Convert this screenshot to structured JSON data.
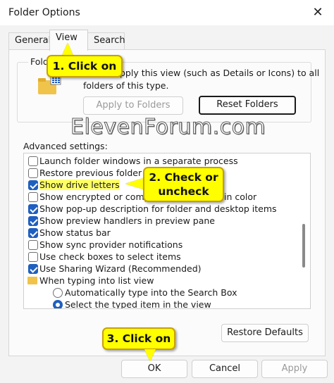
{
  "window": {
    "title": "Folder Options",
    "close_glyph": "✕"
  },
  "tabs": [
    {
      "label": "General"
    },
    {
      "label": "View"
    },
    {
      "label": "Search"
    }
  ],
  "folder_views": {
    "group_label": "Fold",
    "desc_line1": "pply this view (such as Details or Icons) to all",
    "desc_line2": "folders of this type.",
    "apply_button": "Apply to Folders",
    "reset_button": "Reset Folders"
  },
  "watermark": "ElevenForum.com",
  "advanced": {
    "label": "Advanced settings:",
    "items": [
      {
        "type": "checkbox",
        "checked": false,
        "label": "Launch folder windows in a separate process"
      },
      {
        "type": "checkbox",
        "checked": false,
        "label": "Restore previous folder"
      },
      {
        "type": "checkbox",
        "checked": true,
        "label": "Show drive letters"
      },
      {
        "type": "checkbox",
        "checked": false,
        "label": "Show encrypted or comp",
        "label_tail": "in color"
      },
      {
        "type": "checkbox",
        "checked": true,
        "label": "Show pop-up description for folder and desktop items"
      },
      {
        "type": "checkbox",
        "checked": true,
        "label": "Show preview handlers in preview pane"
      },
      {
        "type": "checkbox",
        "checked": true,
        "label": "Show status bar"
      },
      {
        "type": "checkbox",
        "checked": false,
        "label": "Show sync provider notifications"
      },
      {
        "type": "checkbox",
        "checked": false,
        "label": "Use check boxes to select items"
      },
      {
        "type": "checkbox",
        "checked": true,
        "label": "Use Sharing Wizard (Recommended)"
      },
      {
        "type": "folder",
        "label": "When typing into list view"
      },
      {
        "type": "radio",
        "checked": false,
        "label": "Automatically type into the Search Box"
      },
      {
        "type": "radio",
        "checked": true,
        "label": "Select the typed item in the view"
      }
    ]
  },
  "buttons": {
    "restore_defaults": "Restore Defaults",
    "ok": "OK",
    "cancel": "Cancel",
    "apply": "Apply"
  },
  "callouts": {
    "one": "1. Click on",
    "two_line1": "2. Check or",
    "two_line2": "uncheck",
    "three": "3. Click on"
  },
  "colors": {
    "accent": "#1f5fbf",
    "callout": "#ffff00",
    "highlight": "#ffff66"
  }
}
